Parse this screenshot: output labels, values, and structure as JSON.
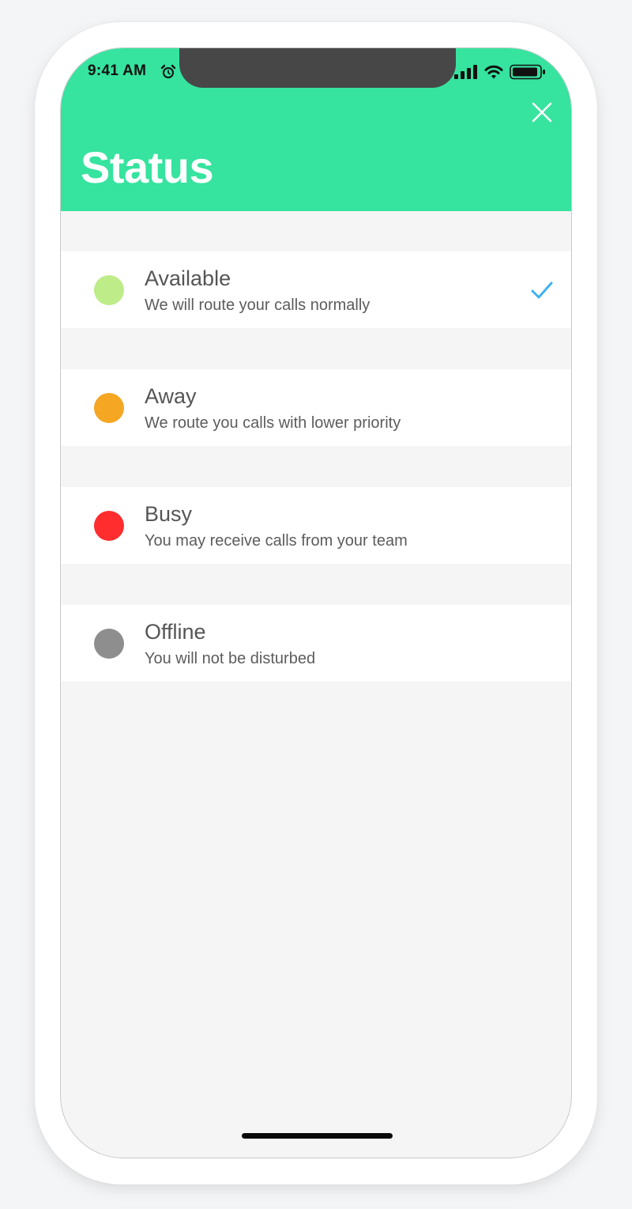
{
  "status_bar": {
    "time": "9:41 AM",
    "alarm_icon": "alarm-clock-icon",
    "signal_icon": "cellular-signal-icon",
    "wifi_icon": "wifi-icon",
    "battery_icon": "battery-icon"
  },
  "header": {
    "title": "Status",
    "close_icon": "close-icon",
    "background": "#36e39f"
  },
  "statuses": [
    {
      "label": "Available",
      "description": "We will route your calls normally",
      "color": "#bdec88",
      "selected": true
    },
    {
      "label": "Away",
      "description": "We route you calls with lower priority",
      "color": "#f5a623",
      "selected": false
    },
    {
      "label": "Busy",
      "description": "You may receive calls from your team",
      "color": "#ff2d2d",
      "selected": false
    },
    {
      "label": "Offline",
      "description": "You will not be disturbed",
      "color": "#8e8e8e",
      "selected": false
    }
  ],
  "check_icon": "checkmark-icon",
  "accent": "#3fb2f0"
}
